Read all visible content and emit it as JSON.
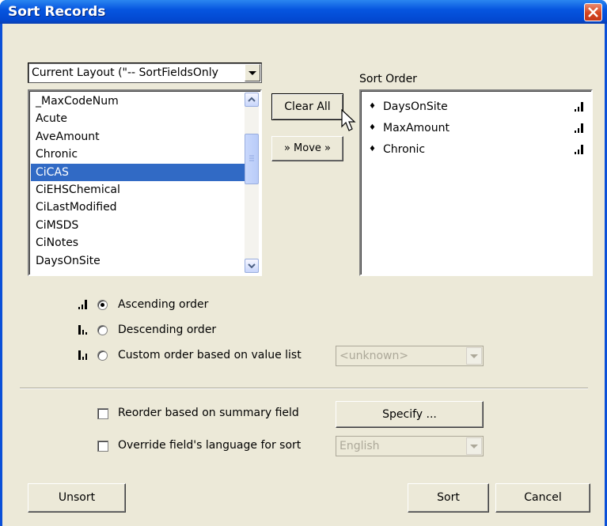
{
  "window": {
    "title": "Sort Records"
  },
  "layout_select": {
    "value": "Current Layout (\"-- SortFieldsOnly"
  },
  "field_list": {
    "items": [
      "_MaxCodeNum",
      "Acute",
      "AveAmount",
      "Chronic",
      "CiCAS",
      "CiEHSChemical",
      "CiLastModified",
      "CiMSDS",
      "CiNotes",
      "DaysOnSite"
    ],
    "selected_index": 4
  },
  "buttons": {
    "clear_all": "Clear All",
    "move": "» Move »",
    "specify": "Specify ...",
    "unsort": "Unsort",
    "sort": "Sort",
    "cancel": "Cancel"
  },
  "sort_order": {
    "label": "Sort Order",
    "items": [
      "DaysOnSite",
      "MaxAmount",
      "Chronic"
    ]
  },
  "options": {
    "ascending": "Ascending order",
    "descending": "Descending order",
    "custom": "Custom order based on value list",
    "value_list": "<unknown>",
    "selected": "ascending"
  },
  "summary": {
    "label": "Reorder based on summary field",
    "checked": false
  },
  "language": {
    "label": "Override field's language for sort",
    "checked": false,
    "value": "English"
  },
  "colors": {
    "title_bar": "#0b50d8",
    "selection": "#316ac5",
    "dialog_bg": "#ece9d8"
  }
}
